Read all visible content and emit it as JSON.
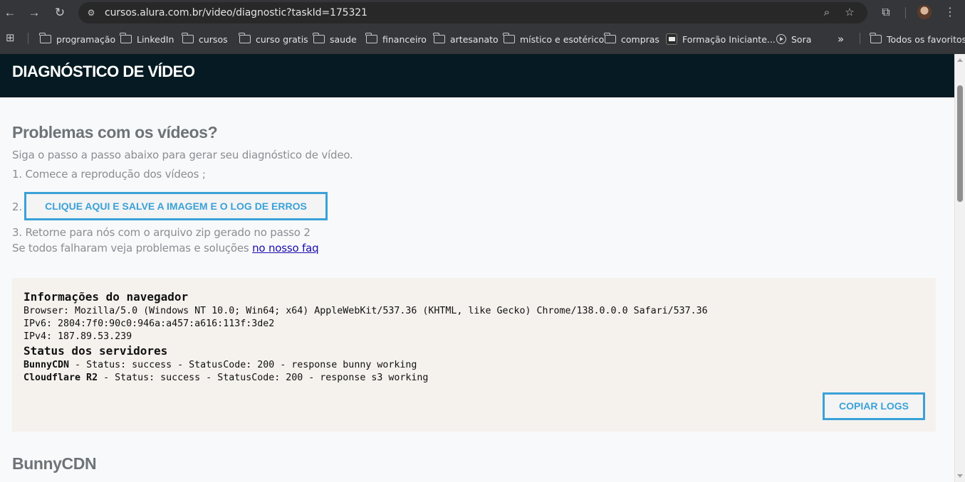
{
  "browser": {
    "url": "cursos.alura.com.br/video/diagnostic?taskId=175321",
    "bookmarks": [
      {
        "label": "programação",
        "icon": "folder-icon"
      },
      {
        "label": "LinkedIn",
        "icon": "folder-icon"
      },
      {
        "label": "cursos",
        "icon": "folder-icon"
      },
      {
        "label": "curso gratis",
        "icon": "folder-icon"
      },
      {
        "label": "saude",
        "icon": "folder-icon"
      },
      {
        "label": "financeiro",
        "icon": "folder-icon"
      },
      {
        "label": "artesanato",
        "icon": "folder-icon"
      },
      {
        "label": "místico e esotérico",
        "icon": "folder-icon"
      },
      {
        "label": "compras",
        "icon": "folder-icon"
      },
      {
        "label": "Formação Iniciante...",
        "icon": "site-icon"
      },
      {
        "label": "Sora",
        "icon": "sora-icon"
      }
    ],
    "overflow_label": "»",
    "all_bookmarks_label": "Todos os favoritos"
  },
  "page": {
    "header_title": "DIAGNÓSTICO DE VÍDEO",
    "heading": "Problemas com os vídeos?",
    "intro": "Siga o passo a passo abaixo para gerar seu diagnóstico de vídeo.",
    "step1": "1. Comece a reprodução dos vídeos ;",
    "step2_number": "2.",
    "step2_button": "CLIQUE AQUI E SALVE A IMAGEM E O LOG DE ERROS",
    "step3": "3. Retorne para nós com o arquivo zip gerado no passo 2",
    "faq_prefix": "Se todos falharam veja problemas e soluções ",
    "faq_link": "no nosso faq",
    "section_heading": "BunnyCDN"
  },
  "logs": {
    "browser_info_title": "Informações do navegador",
    "browser_line": "Browser: Mozilla/5.0 (Windows NT 10.0; Win64; x64) AppleWebKit/537.36 (KHTML, like Gecko) Chrome/138.0.0.0 Safari/537.36",
    "ipv6_line": "IPv6: 2804:7f0:90c0:946a:a457:a616:113f:3de2",
    "ipv4_line": "IPv4: 187.89.53.239",
    "server_status_title": "Status dos servidores",
    "servers": [
      {
        "name": "BunnyCDN",
        "detail": " - Status: success - StatusCode: 200 - response bunny working"
      },
      {
        "name": "Cloudflare R2",
        "detail": " - Status: success - StatusCode: 200 - response s3 working"
      }
    ],
    "copy_button": "COPIAR LOGS"
  },
  "colors": {
    "header_bg": "#051a22",
    "accent": "#3aa1d8",
    "text_muted": "#8a8e92",
    "link": "#1a0dab",
    "log_bg": "#f5f2ee"
  }
}
